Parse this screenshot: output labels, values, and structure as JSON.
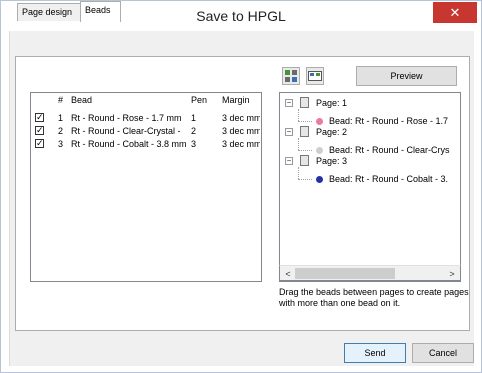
{
  "window": {
    "title": "Save to HPGL",
    "close_glyph": "✕"
  },
  "tabs": [
    {
      "label": "Page design",
      "active": false
    },
    {
      "label": "Beads",
      "active": true
    }
  ],
  "beads_list": {
    "headers": [
      "#",
      "Bead",
      "Pen",
      "Margin"
    ],
    "rows": [
      {
        "checked": true,
        "num": "1",
        "bead": "Rt - Round - Rose - 1.7 mm",
        "pen": "1",
        "margin": "3 dec mm"
      },
      {
        "checked": true,
        "num": "2",
        "bead": "Rt - Round - Clear-Crystal -",
        "pen": "2",
        "margin": "3 dec mm"
      },
      {
        "checked": true,
        "num": "3",
        "bead": "Rt - Round - Cobalt - 3.8 mm",
        "pen": "3",
        "margin": "3 dec mm"
      }
    ]
  },
  "toolbar": {
    "icons": [
      "page-add-icon",
      "page-layout-icon"
    ],
    "preview_label": "Preview"
  },
  "tree": {
    "pages": [
      {
        "label": "Page: 1",
        "bead": "Bead: Rt - Round - Rose - 1.7",
        "color": "#e87aa5"
      },
      {
        "label": "Page: 2",
        "bead": "Bead: Rt - Round - Clear-Crys",
        "color": "#cfcfcf"
      },
      {
        "label": "Page: 3",
        "bead": "Bead: Rt - Round - Cobalt - 3.",
        "color": "#2233aa"
      }
    ],
    "expander_glyph": "−",
    "scroll_left_glyph": "<",
    "scroll_right_glyph": ">"
  },
  "hint": "Drag the beads between pages to create pages with more than one bead on it.",
  "footer": {
    "send_label": "Send",
    "cancel_label": "Cancel"
  }
}
